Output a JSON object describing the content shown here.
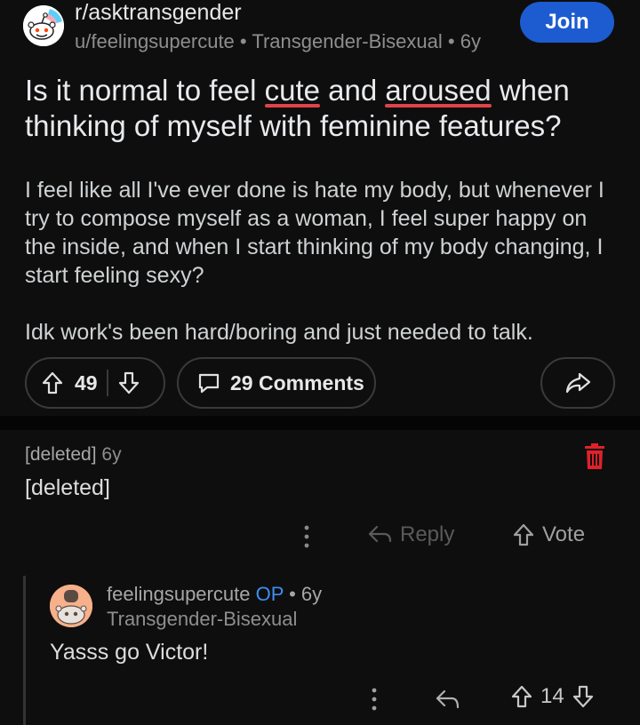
{
  "header": {
    "subreddit": "r/asktransgender",
    "author": "u/feelingsupercute",
    "flair": "Transgender-Bisexual",
    "age": "6y",
    "join_label": "Join"
  },
  "post": {
    "title_parts": [
      "Is it normal to feel ",
      "cute",
      " and ",
      "aroused",
      " when thinking of myself with feminine features?"
    ],
    "body": [
      "I feel like all I've ever done is hate my body, but whenever I try to compose myself as a woman, I feel super happy on the inside, and when I start thinking of my body changing, I start feeling sexy?",
      "Idk work's been hard/boring and just needed to talk."
    ],
    "upvotes": "49",
    "comments_label": "29 Comments"
  },
  "comments": [
    {
      "author": "[deleted]",
      "age": "6y",
      "body": "[deleted]",
      "reply_label": "Reply",
      "vote_label": "Vote"
    },
    {
      "author": "feelingsupercute",
      "op_badge": "OP",
      "age": "6y",
      "flair": "Transgender-Bisexual",
      "body": "Yasss go Victor!",
      "score": "14"
    }
  ],
  "icons": {
    "upvote": "arrow-up-icon",
    "downvote": "arrow-down-icon",
    "comment": "comment-bubble-icon",
    "share": "share-arrow-icon",
    "delete": "trash-icon",
    "more": "more-vertical-icon",
    "reply": "reply-arrow-icon"
  },
  "colors": {
    "join_button": "#1d5bd0",
    "op_badge": "#3d8ef0",
    "delete_icon": "#e0212a",
    "spellcheck_underline": "#e0434a"
  }
}
